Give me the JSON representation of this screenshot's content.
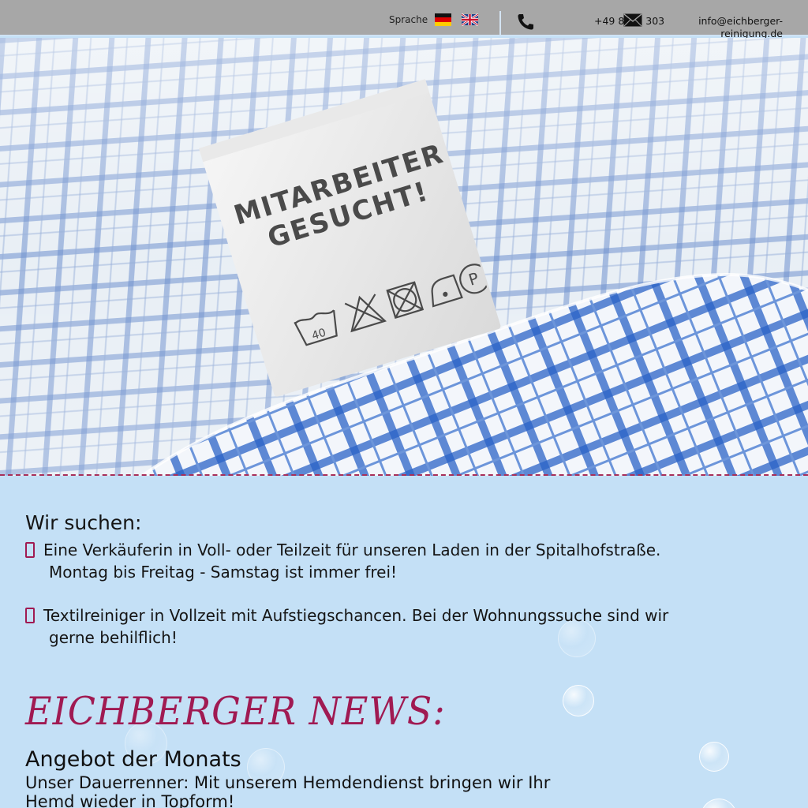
{
  "topbar": {
    "language_label": "Sprache",
    "languages": [
      {
        "name": "Deutsch",
        "icon": "flag-de-icon"
      },
      {
        "name": "English",
        "icon": "flag-uk-icon"
      }
    ],
    "phone": "+49 85",
    "phone_suffix": "303",
    "email_line1": "info@eichberger-",
    "email_line2": "reinigung.de"
  },
  "hero": {
    "tag_line1": "MITARBEITER",
    "tag_line2": "GESUCHT!",
    "tag_care_number": "40"
  },
  "jobs": {
    "heading": "Wir suchen:",
    "items": [
      {
        "line1": "Eine Verkäuferin in Voll- oder Teilzeit für unseren Laden in der Spitalhofstraße.",
        "line2": "Montag bis Freitag - Samstag ist immer frei!"
      },
      {
        "line1": "Textilreiniger in Vollzeit mit Aufstiegschancen. Bei der Wohnungssuche sind wir",
        "line2": "gerne behilflich!"
      }
    ]
  },
  "news": {
    "title": "EICHBERGER NEWS:",
    "offer_title": "Angebot der Monats",
    "offer_text": "Unser Dauerrenner: Mit unserem Hemdendienst bringen wir Ihr Hemd wieder in Topform!"
  },
  "colors": {
    "accent": "#a01a52",
    "background": "#c4e0f6",
    "topbar": "#a7a7a7"
  }
}
